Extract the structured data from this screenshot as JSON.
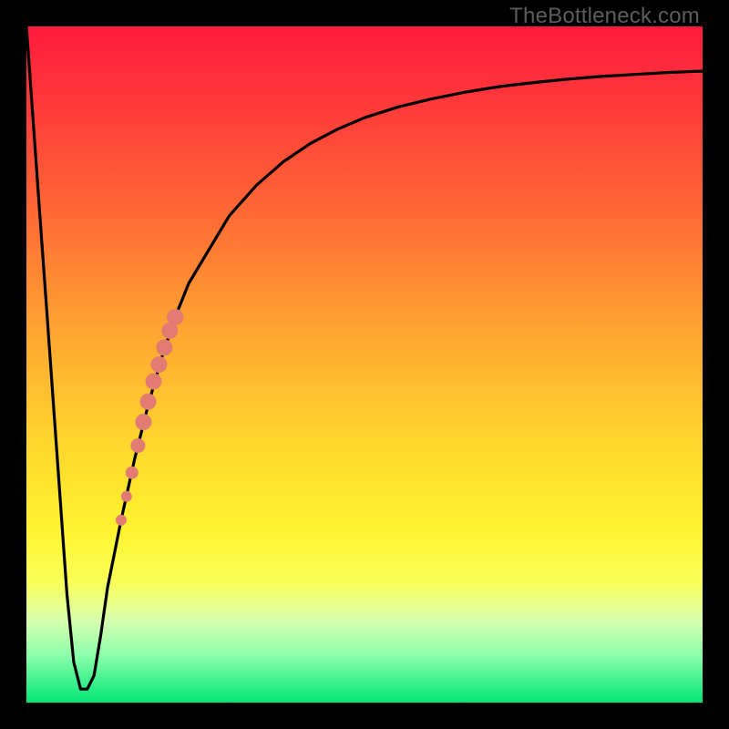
{
  "watermark": "TheBottleneck.com",
  "colors": {
    "curve": "#000000",
    "dots": "#e27b72",
    "frame": "#000000"
  },
  "chart_data": {
    "type": "line",
    "title": "",
    "xlabel": "",
    "ylabel": "",
    "xlim": [
      0,
      100
    ],
    "ylim": [
      0,
      100
    ],
    "grid": false,
    "legend": false,
    "series": [
      {
        "name": "bottleneck-curve",
        "x": [
          0,
          1,
          2,
          3,
          4,
          5,
          6,
          7,
          8,
          9,
          10,
          11,
          12,
          14,
          16,
          18,
          20,
          22,
          24,
          27,
          30,
          34,
          38,
          42,
          46,
          50,
          55,
          60,
          65,
          70,
          75,
          80,
          85,
          90,
          95,
          100
        ],
        "y": [
          100,
          86,
          72,
          58,
          44,
          30,
          16,
          6,
          2,
          2,
          4,
          10,
          17,
          27,
          36,
          44,
          51,
          57,
          62,
          67,
          72,
          76.5,
          80,
          82.7,
          84.8,
          86.5,
          88.1,
          89.3,
          90.3,
          91.1,
          91.7,
          92.2,
          92.6,
          92.9,
          93.2,
          93.4
        ]
      }
    ],
    "highlighted_points": {
      "name": "salmon-dots",
      "color": "#e27b72",
      "points": [
        {
          "x": 14.0,
          "y": 27.0,
          "r": 6
        },
        {
          "x": 14.8,
          "y": 30.5,
          "r": 6
        },
        {
          "x": 15.6,
          "y": 34.0,
          "r": 7
        },
        {
          "x": 16.5,
          "y": 38.0,
          "r": 8
        },
        {
          "x": 17.3,
          "y": 41.5,
          "r": 9
        },
        {
          "x": 18.0,
          "y": 44.5,
          "r": 9
        },
        {
          "x": 18.8,
          "y": 47.5,
          "r": 9
        },
        {
          "x": 19.6,
          "y": 50.0,
          "r": 9
        },
        {
          "x": 20.4,
          "y": 52.5,
          "r": 9
        },
        {
          "x": 21.2,
          "y": 55.0,
          "r": 9
        },
        {
          "x": 22.0,
          "y": 57.0,
          "r": 9
        }
      ]
    }
  }
}
